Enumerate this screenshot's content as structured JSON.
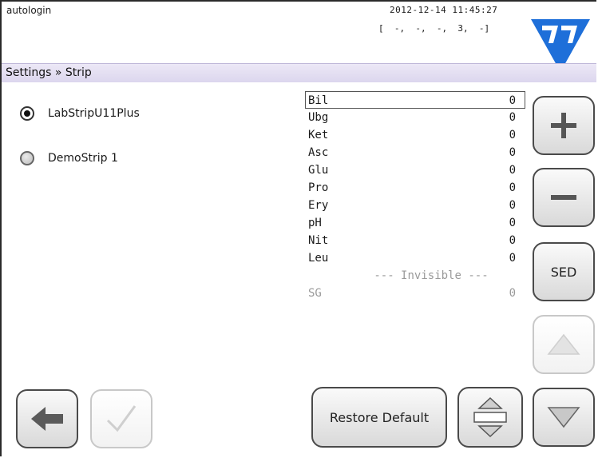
{
  "header": {
    "user": "autologin",
    "datetime": "2012-12-14 11:45:27",
    "status": "[  -,  -,  -,  3,  -]",
    "logo": "77-logo-icon",
    "brand_color": "#1e6fd9"
  },
  "breadcrumb": "Settings » Strip",
  "strips": [
    {
      "label": "LabStripU11Plus",
      "checked": true
    },
    {
      "label": "DemoStrip 1",
      "checked": false
    }
  ],
  "parameters": {
    "visible": [
      {
        "name": "Bil",
        "value": "0"
      },
      {
        "name": "Ubg",
        "value": "0"
      },
      {
        "name": "Ket",
        "value": "0"
      },
      {
        "name": "Asc",
        "value": "0"
      },
      {
        "name": "Glu",
        "value": "0"
      },
      {
        "name": "Pro",
        "value": "0"
      },
      {
        "name": "Ery",
        "value": "0"
      },
      {
        "name": "pH",
        "value": "0"
      },
      {
        "name": "Nit",
        "value": "0"
      },
      {
        "name": "Leu",
        "value": "0"
      }
    ],
    "invisible_heading": "--- Invisible ---",
    "invisible": [
      {
        "name": "SG",
        "value": "0"
      }
    ]
  },
  "buttons": {
    "plus": "plus-icon",
    "minus": "minus-icon",
    "sed": "SED",
    "up": "triangle-up-icon",
    "down": "triangle-down-icon",
    "back": "back-arrow-icon",
    "ok": "checkmark-icon",
    "restore": "Restore Default",
    "scroll": "up-down-icon"
  }
}
